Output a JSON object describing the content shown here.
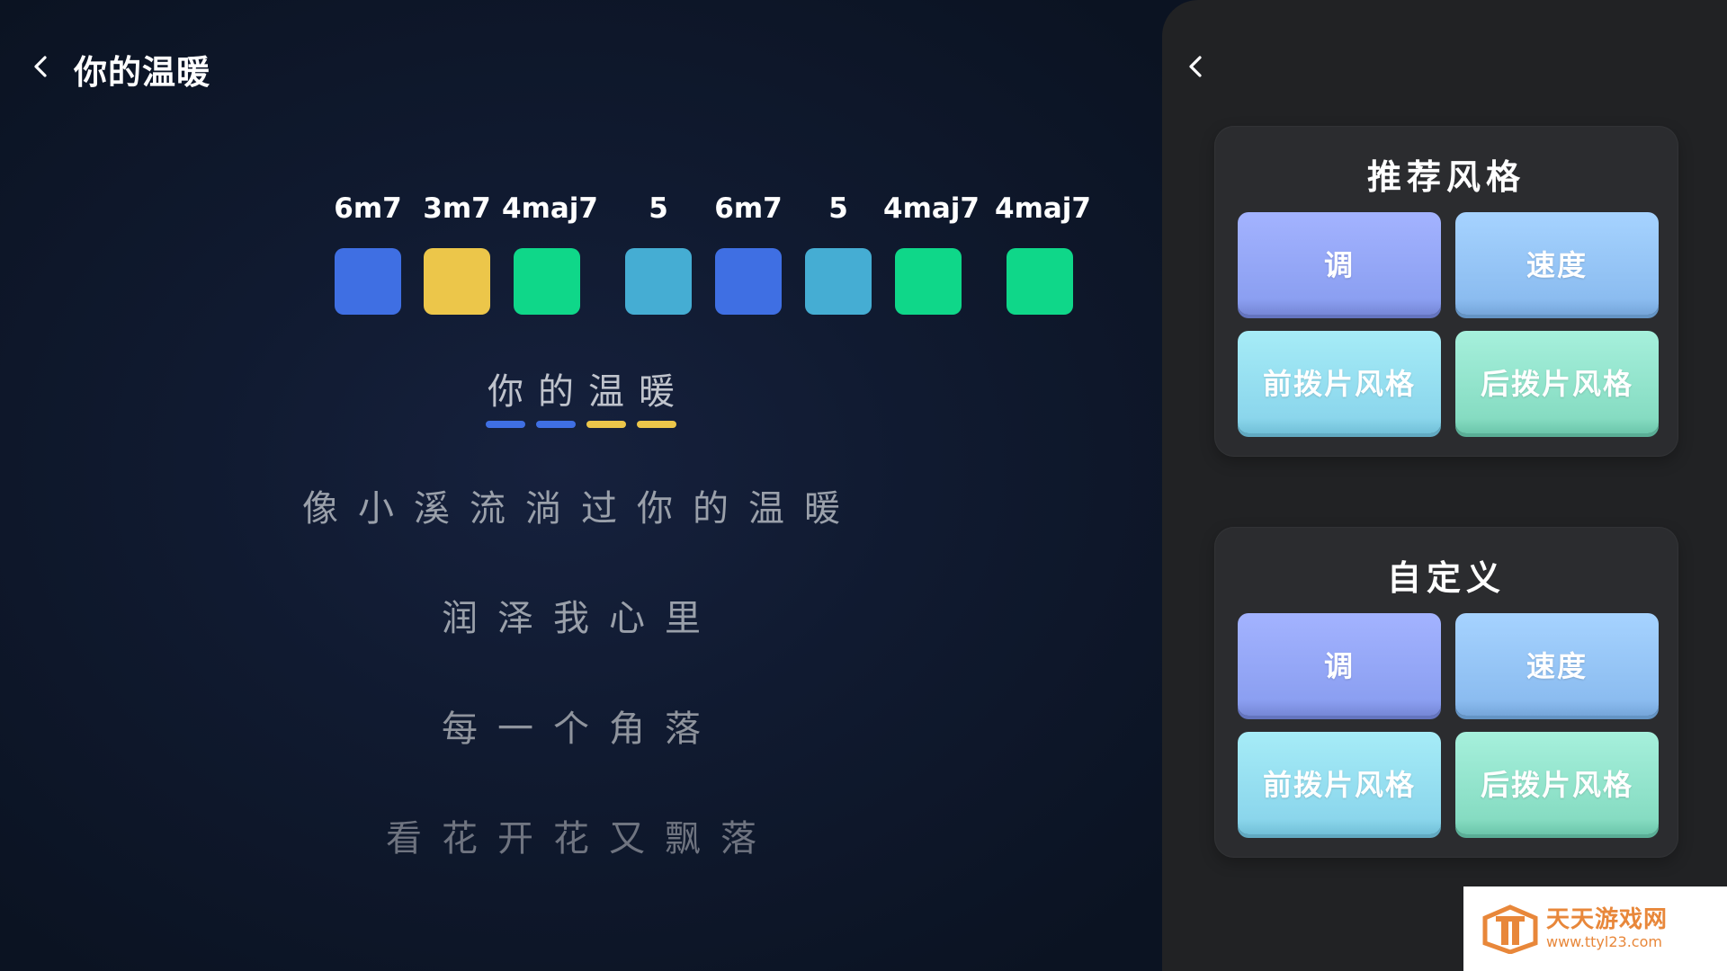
{
  "header": {
    "title": "你的温暖",
    "back_icon": "chevron-left-icon"
  },
  "chords": [
    {
      "label": "6m7",
      "color": "#3f6fe3"
    },
    {
      "label": "3m7",
      "color": "#ecc64a"
    },
    {
      "label": "4maj7",
      "color": "#0fd789"
    },
    {
      "label": "5",
      "color": "#45add3"
    },
    {
      "label": "6m7",
      "color": "#3f6fe3"
    },
    {
      "label": "5",
      "color": "#45add3"
    },
    {
      "label": "4maj7",
      "color": "#0fd789"
    },
    {
      "label": "4maj7",
      "color": "#0fd789"
    }
  ],
  "lyrics": {
    "current": [
      {
        "char": "你",
        "underline": "#3f6fe3"
      },
      {
        "char": "的",
        "underline": "#3f6fe3"
      },
      {
        "char": "温",
        "underline": "#ecc64a"
      },
      {
        "char": "暖",
        "underline": "#ecc64a"
      }
    ],
    "line2": "像小溪流淌过你的温暖",
    "line3": "润泽我心里",
    "line4": "每一个角落",
    "line5": "看花开花又飘落"
  },
  "side_panel": {
    "back_icon": "chevron-left-icon",
    "recommended": {
      "title": "推荐风格",
      "key": "调",
      "speed": "速度",
      "front_pick": "前拨片风格",
      "back_pick": "后拨片风格"
    },
    "custom": {
      "title": "自定义",
      "key": "调",
      "speed": "速度",
      "front_pick": "前拨片风格",
      "back_pick": "后拨片风格"
    }
  },
  "watermark": {
    "name": "天天游戏网",
    "url": "www.ttyl23.com"
  }
}
